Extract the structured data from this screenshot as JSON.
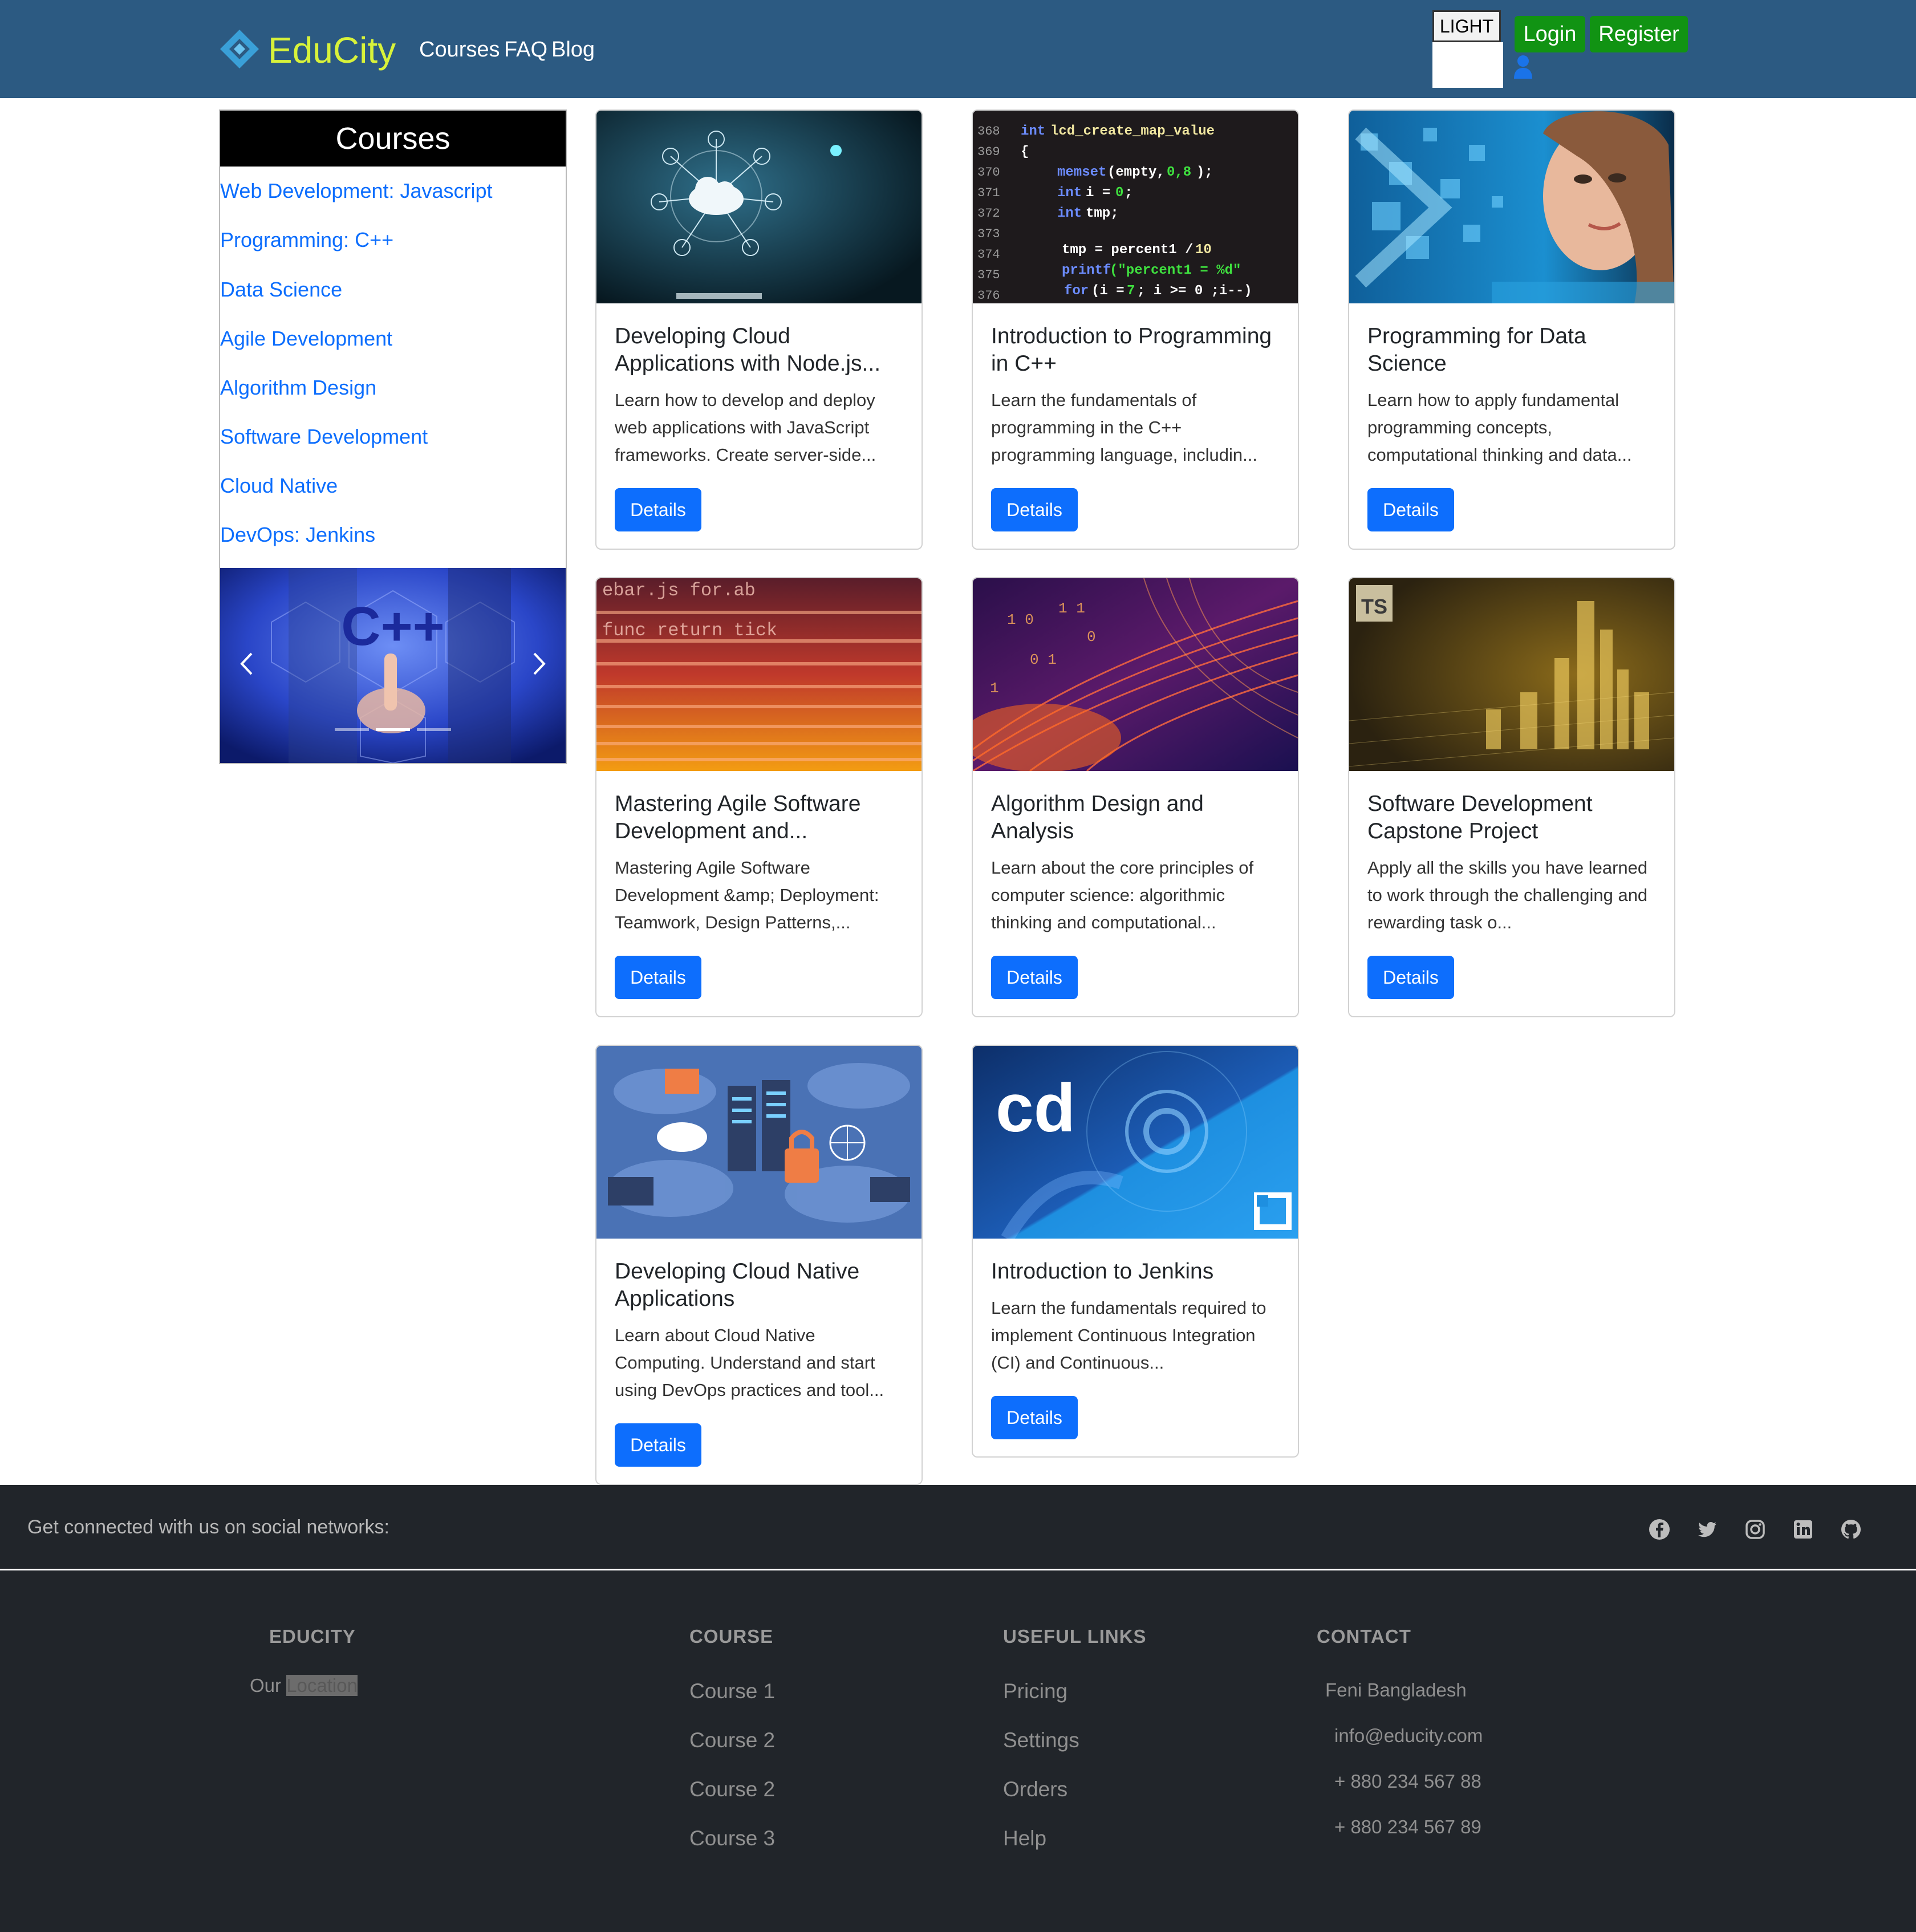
{
  "header": {
    "brand": "EduCity",
    "nav": [
      "Courses",
      "FAQ",
      "Blog"
    ],
    "theme_label": "LIGHT",
    "login_label": "Login",
    "register_label": "Register",
    "bg_color": "#2c5a82",
    "brand_color": "#d8f23a",
    "button_color": "#119313"
  },
  "sidebar": {
    "title": "Courses",
    "links": [
      "Web Development: Javascript",
      "Programming: C++",
      "Data Science",
      "Agile Development",
      "Algorithm Design",
      "Software Development",
      "Cloud Native",
      "DevOps: Jenkins"
    ],
    "carousel": {
      "image_text": "C++",
      "active_slide": 2,
      "slide_count": 3
    }
  },
  "cards": [
    {
      "title": "Developing Cloud Applications with Node.js...",
      "text": "Learn how to develop and deploy web applications with JavaScript frameworks. Create server-side...",
      "button": "Details",
      "image": "cloud-network"
    },
    {
      "title": "Introduction to Programming in C++",
      "text": "Learn the fundamentals of programming in the C++ programming language, includin...",
      "button": "Details",
      "image": "code-screen"
    },
    {
      "title": "Programming for Data Science",
      "text": "Learn how to apply fundamental programming concepts, computational thinking and data...",
      "button": "Details",
      "image": "data-science-woman"
    },
    {
      "title": "Mastering Agile Software Development and...",
      "text": "Mastering Agile Software Development &amp; Deployment: Teamwork, Design Patterns,...",
      "button": "Details",
      "image": "agile-code-streams"
    },
    {
      "title": "Algorithm Design and Analysis",
      "text": "Learn about the core principles of computer science: algorithmic thinking and computational...",
      "button": "Details",
      "image": "algorithm-waves"
    },
    {
      "title": "Software Development Capstone Project",
      "text": "Apply all the skills you have learned to work through the challenging and rewarding task o...",
      "button": "Details",
      "image": "typescript-city",
      "badge": "TS"
    },
    {
      "title": "Developing Cloud Native Applications",
      "text": "Learn about Cloud Native Computing. Understand and start using DevOps practices and tool...",
      "button": "Details",
      "image": "cloud-native-illustration"
    },
    {
      "title": "Introduction to Jenkins",
      "text": "Learn the fundamentals required to implement Continuous Integration (CI) and Continuous...",
      "button": "Details",
      "image": "cd-foundation",
      "badge": "cd"
    }
  ],
  "footer": {
    "social_text": "Get connected with us on social networks:",
    "social_icons": [
      "facebook-icon",
      "twitter-icon",
      "instagram-icon",
      "linkedin-icon",
      "github-icon"
    ],
    "educity": {
      "heading": "EDUCITY",
      "text_prefix": "Our",
      "text_highlight": "Location"
    },
    "course": {
      "heading": "COURSE",
      "links": [
        "Course 1",
        "Course 2",
        "Course 2",
        "Course 3"
      ]
    },
    "useful": {
      "heading": "USEFUL LINKS",
      "links": [
        "Pricing",
        "Settings",
        "Orders",
        "Help"
      ]
    },
    "contact": {
      "heading": "CONTACT",
      "items": [
        "Feni Bangladesh",
        "info@educity.com",
        "+ 880 234 567 88",
        "+ 880 234 567 89"
      ]
    },
    "bg_color": "#21252a"
  }
}
